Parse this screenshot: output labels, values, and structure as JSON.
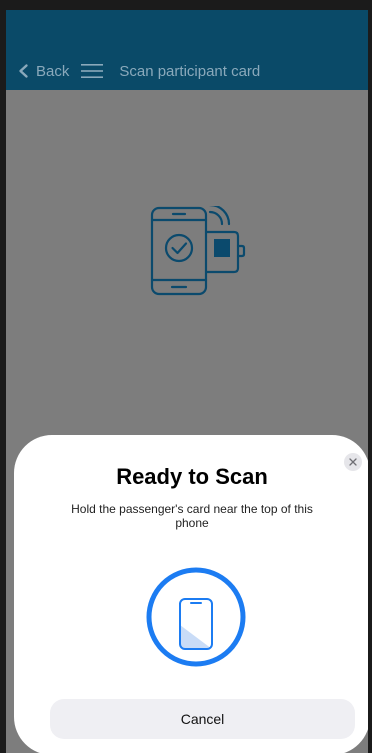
{
  "header": {
    "back_label": "Back",
    "title": "Scan participant card",
    "back_icon": "chevron-left-icon",
    "menu_icon": "hamburger-menu-icon"
  },
  "illustration": {
    "icon": "phone-nfc-card-icon"
  },
  "scan_sheet": {
    "title": "Ready to Scan",
    "message": "Hold the passenger's card near the top of this phone",
    "cancel_label": "Cancel",
    "close_icon": "close-icon",
    "graphic_icon": "phone-scan-icon"
  },
  "colors": {
    "header_background": "#0a4a68",
    "header_text": "#8aa9bb",
    "overlay": "#7d7d7d",
    "illustration_stroke": "#0b4a6d",
    "scan_ring": "#1c7cf2",
    "cancel_button_background": "#efeff3"
  }
}
